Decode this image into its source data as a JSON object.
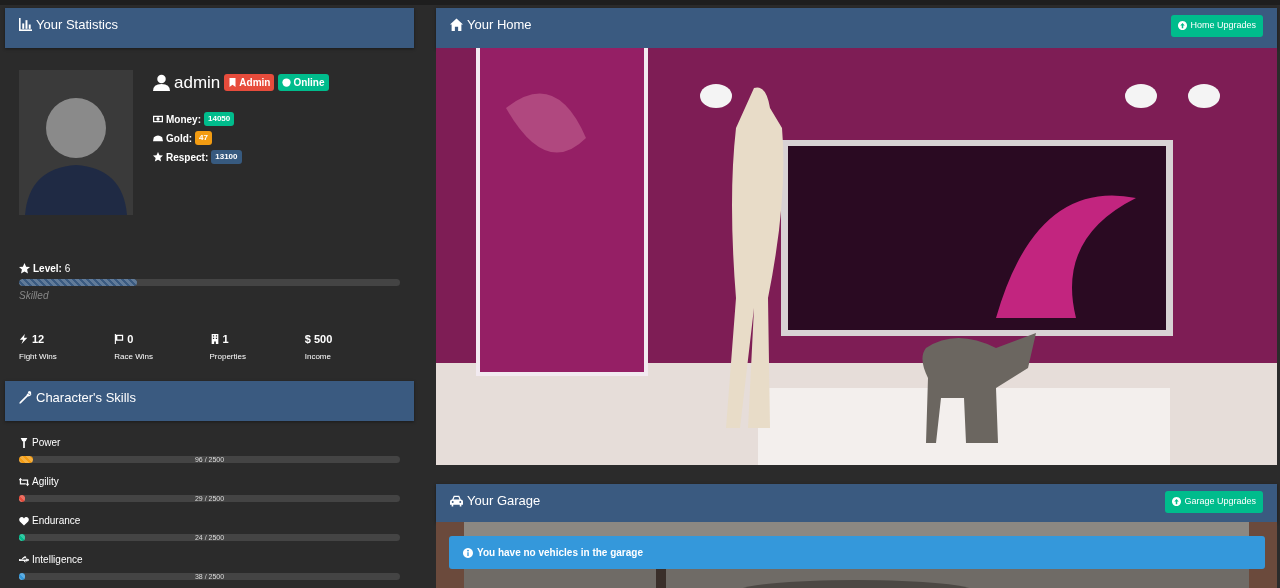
{
  "stats_panel": {
    "title": "Your Statistics",
    "username": "admin",
    "badges": [
      {
        "kind": "role",
        "label": "Admin",
        "color": "#e74c3c"
      },
      {
        "kind": "status",
        "label": "Online",
        "color": "#00bc8c"
      }
    ],
    "resources": [
      {
        "label": "Money:",
        "value": "14050",
        "color": "#00bc8c"
      },
      {
        "label": "Gold:",
        "value": "47",
        "color": "#f39c12"
      },
      {
        "label": "Respect:",
        "value": "13100",
        "color": "#375a7f"
      }
    ],
    "level": {
      "label": "Level:",
      "value": "6",
      "level": 0.31,
      "rank": "Skilled"
    },
    "counters": [
      {
        "value": "12",
        "label": "Fight Wins"
      },
      {
        "value": "0",
        "label": "Race Wins"
      },
      {
        "value": "1",
        "label": "Properties"
      },
      {
        "value": "$ 500",
        "label": "Income"
      }
    ]
  },
  "skills_panel": {
    "title": "Character's Skills",
    "skills": [
      {
        "name": "Power",
        "reading": "96 / 2500",
        "level": 0.038,
        "color": "#f39c12"
      },
      {
        "name": "Agility",
        "reading": "29 / 2500",
        "level": 0.012,
        "color": "#e74c3c"
      },
      {
        "name": "Endurance",
        "reading": "24 / 2500",
        "level": 0.01,
        "color": "#00bc8c"
      },
      {
        "name": "Intelligence",
        "reading": "38 / 2500",
        "level": 0.015,
        "color": "#3498db"
      }
    ]
  },
  "home_panel": {
    "title": "Your Home",
    "button": "Home Upgrades"
  },
  "garage_panel": {
    "title": "Your Garage",
    "button": "Garage Upgrades",
    "alert": "You have no vehicles in the garage"
  }
}
